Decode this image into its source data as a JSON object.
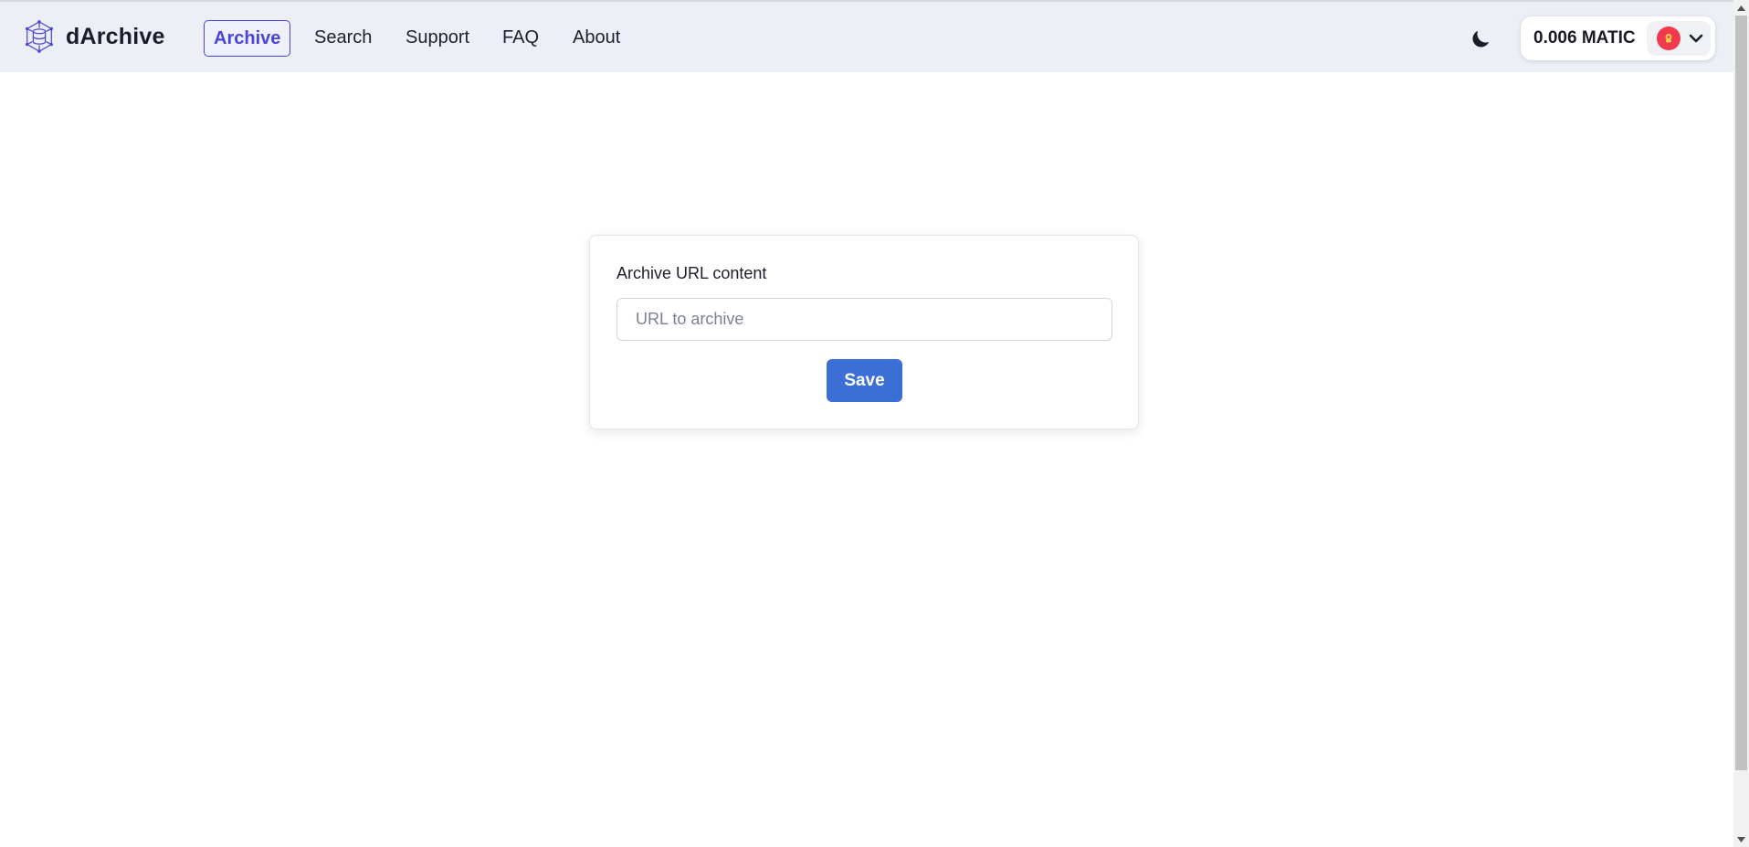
{
  "brand": {
    "name": "dArchive",
    "icon": "cube-network-logo-icon"
  },
  "nav": {
    "items": [
      {
        "label": "Archive",
        "active": true
      },
      {
        "label": "Search",
        "active": false
      },
      {
        "label": "Support",
        "active": false
      },
      {
        "label": "FAQ",
        "active": false
      },
      {
        "label": "About",
        "active": false
      }
    ]
  },
  "header": {
    "theme_toggle_icon": "moon-icon",
    "wallet": {
      "balance": "0.006 MATIC",
      "avatar_icon": "account-avatar-icon",
      "dropdown_icon": "chevron-down-icon"
    }
  },
  "archive_form": {
    "label": "Archive URL content",
    "url_input": {
      "value": "",
      "placeholder": "URL to archive"
    },
    "save_label": "Save"
  },
  "colors": {
    "navbar_bg": "#eceff6",
    "accent": "#4a45d8",
    "button": "#3b6fd6",
    "avatar": "#f0394d"
  }
}
